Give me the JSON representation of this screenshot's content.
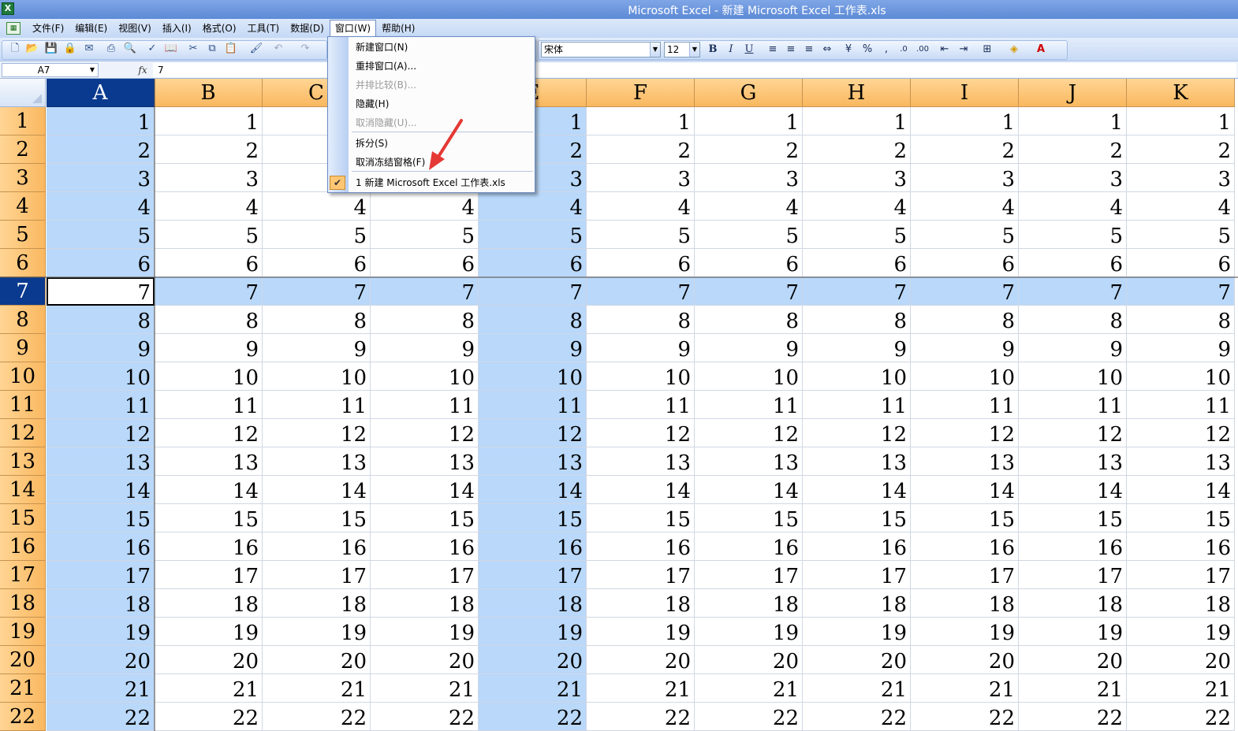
{
  "window": {
    "title": "Microsoft Excel - 新建 Microsoft Excel 工作表.xls",
    "icon_text": "X"
  },
  "menubar": {
    "items": [
      "文件(F)",
      "编辑(E)",
      "视图(V)",
      "插入(I)",
      "格式(O)",
      "工具(T)",
      "数据(D)",
      "窗口(W)",
      "帮助(H)"
    ]
  },
  "toolbar": {
    "font_name": "宋体",
    "font_size": "12"
  },
  "formula_bar": {
    "name_box": "A7",
    "fx": "fx",
    "value": "7"
  },
  "window_menu": {
    "items": [
      {
        "label": "新建窗口(N)",
        "disabled": false
      },
      {
        "label": "重排窗口(A)...",
        "disabled": false
      },
      {
        "label": "并排比较(B)...",
        "disabled": true
      },
      {
        "label": "隐藏(H)",
        "disabled": false
      },
      {
        "label": "取消隐藏(U)...",
        "disabled": true
      },
      {
        "label": "拆分(S)",
        "disabled": false
      },
      {
        "label": "取消冻结窗格(F)",
        "disabled": false
      },
      {
        "label": "1 新建 Microsoft Excel 工作表.xls",
        "disabled": false
      }
    ]
  },
  "sheet": {
    "columns": [
      "A",
      "B",
      "C",
      "D",
      "E",
      "F",
      "G",
      "H",
      "I",
      "J",
      "K"
    ],
    "rows": [
      "1",
      "2",
      "3",
      "4",
      "5",
      "6",
      "7",
      "8",
      "9",
      "10",
      "11",
      "12",
      "13",
      "14",
      "15",
      "16",
      "17",
      "18",
      "19",
      "20",
      "21",
      "22"
    ],
    "values": [
      "1",
      "2",
      "3",
      "4",
      "5",
      "6",
      "7",
      "8",
      "9",
      "10",
      "11",
      "12",
      "13",
      "14",
      "15",
      "16",
      "17",
      "18",
      "19",
      "20",
      "21",
      "22"
    ],
    "active_cell": "A7",
    "highlight_color": "#b9d8fa",
    "header_color": "#fab860",
    "selected_header_color": "#0a3a8f"
  }
}
